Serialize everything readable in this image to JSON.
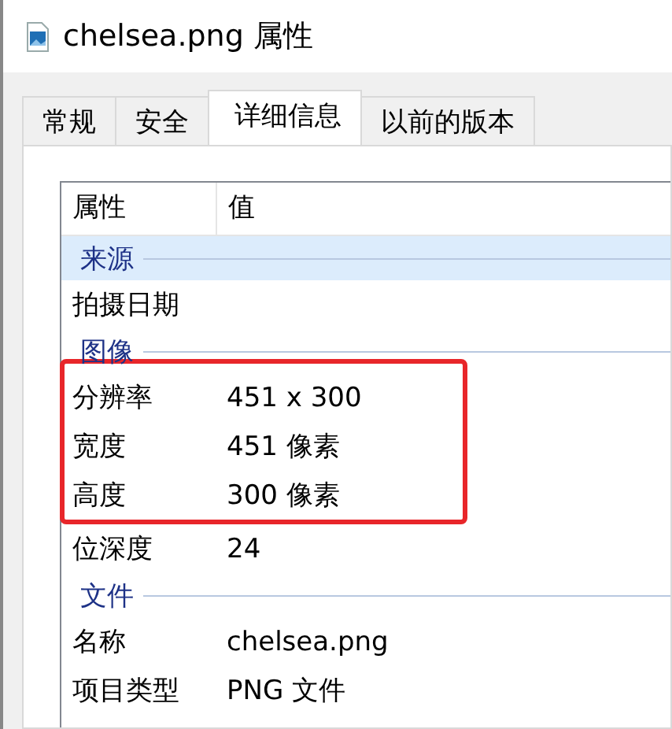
{
  "window": {
    "title": "chelsea.png 属性"
  },
  "tabs": [
    {
      "label": "常规",
      "selected": false
    },
    {
      "label": "安全",
      "selected": false
    },
    {
      "label": "详细信息",
      "selected": true
    },
    {
      "label": "以前的版本",
      "selected": false
    }
  ],
  "table": {
    "columns": [
      "属性",
      "值"
    ],
    "groups": [
      {
        "title": "来源",
        "selected": true,
        "rows": [
          {
            "name": "拍摄日期",
            "highlighted": false
          }
        ]
      },
      {
        "title": "图像",
        "selected": false,
        "rows": [
          {
            "name": "分辨率",
            "value": "451 x 300",
            "highlighted": true
          },
          {
            "name": "宽度",
            "value": "451 像素",
            "highlighted": true
          },
          {
            "name": "高度",
            "value": "300 像素",
            "highlighted": true
          },
          {
            "name": "位深度",
            "value": "24",
            "highlighted": false
          }
        ]
      },
      {
        "title": "文件",
        "selected": false,
        "rows": [
          {
            "name": "名称",
            "value": "chelsea.png",
            "highlighted": false
          },
          {
            "name": "项目类型",
            "value": "PNG 文件",
            "highlighted": false
          }
        ]
      }
    ]
  }
}
